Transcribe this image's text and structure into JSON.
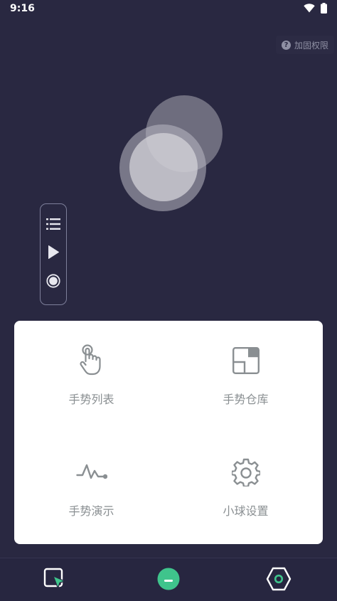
{
  "status": {
    "time": "9:16",
    "wifi_icon": "wifi-icon",
    "battery_icon": "battery-icon"
  },
  "permission": {
    "label": "加固权限",
    "icon": "help-icon"
  },
  "float_toolbar": {
    "items": [
      "list-icon",
      "play-icon",
      "record-icon"
    ]
  },
  "menu": {
    "gesture_list": {
      "label": "手势列表",
      "icon": "touch-hand-icon"
    },
    "gesture_store": {
      "label": "手势仓库",
      "icon": "store-box-icon"
    },
    "gesture_demo": {
      "label": "手势演示",
      "icon": "pulse-wave-icon"
    },
    "ball_settings": {
      "label": "小球设置",
      "icon": "gear-icon"
    }
  },
  "bottom_nav": {
    "items": [
      "select-cursor-icon",
      "minimize-ball-icon",
      "hexagon-settings-icon"
    ],
    "accent_color": "#3fc48c"
  },
  "colors": {
    "background": "#292841",
    "card": "#ffffff",
    "icon_gray": "#8a8f92"
  }
}
